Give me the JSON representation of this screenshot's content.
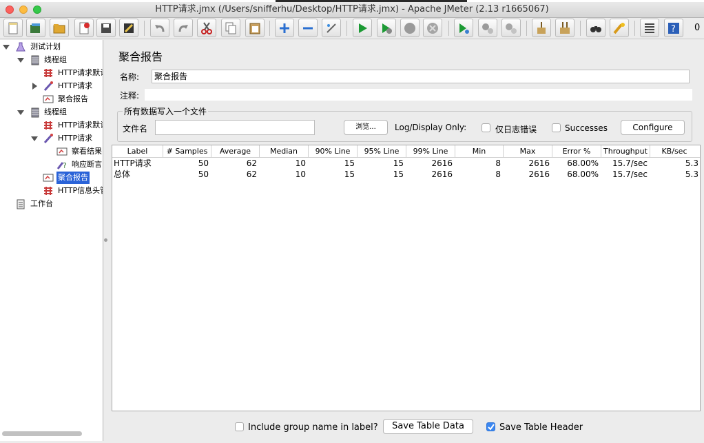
{
  "window": {
    "title": "HTTP请求.jmx (/Users/snifferhu/Desktop/HTTP请求.jmx) - Apache JMeter (2.13 r1665067)"
  },
  "toolbar": {
    "counter": "0"
  },
  "tree": {
    "nodes": [
      {
        "label": "测试计划",
        "icon": "test-plan-icon"
      },
      {
        "label": "线程组",
        "icon": "thread-group-icon"
      },
      {
        "label": "HTTP请求默认",
        "icon": "config-icon"
      },
      {
        "label": "HTTP请求",
        "icon": "sampler-icon"
      },
      {
        "label": "聚合报告",
        "icon": "report-icon"
      },
      {
        "label": "线程组",
        "icon": "thread-group-icon"
      },
      {
        "label": "HTTP请求默认",
        "icon": "config-icon"
      },
      {
        "label": "HTTP请求",
        "icon": "sampler-icon"
      },
      {
        "label": "察看结果",
        "icon": "listener-icon"
      },
      {
        "label": "响应断言",
        "icon": "assertion-icon"
      },
      {
        "label": "聚合报告",
        "icon": "report-icon"
      },
      {
        "label": "HTTP信息头管",
        "icon": "config-icon"
      },
      {
        "label": "工作台",
        "icon": "workbench-icon"
      }
    ]
  },
  "panel": {
    "title": "聚合报告",
    "name_label": "名称:",
    "name_value": "聚合报告",
    "comment_label": "注释:",
    "comment_value": "",
    "file_group_title": "所有数据写入一个文件",
    "filename_label": "文件名",
    "filename_value": "",
    "browse_label": "浏览...",
    "log_display_label": "Log/Display Only:",
    "errors_only_label": "仅日志错误",
    "successes_label": "Successes",
    "configure_label": "Configure"
  },
  "table": {
    "columns": [
      "Label",
      "# Samples",
      "Average",
      "Median",
      "90% Line",
      "95% Line",
      "99% Line",
      "Min",
      "Max",
      "Error %",
      "Throughput",
      "KB/sec"
    ],
    "rows": [
      [
        "HTTP请求",
        "50",
        "62",
        "10",
        "15",
        "15",
        "2616",
        "8",
        "2616",
        "68.00%",
        "15.7/sec",
        "5.3"
      ],
      [
        "总体",
        "50",
        "62",
        "10",
        "15",
        "15",
        "2616",
        "8",
        "2616",
        "68.00%",
        "15.7/sec",
        "5.3"
      ]
    ]
  },
  "footer": {
    "include_group_label": "Include group name in label?",
    "include_group_checked": false,
    "save_table_data_label": "Save Table Data",
    "save_table_header_label": "Save Table Header",
    "save_table_header_checked": true
  },
  "colors": {
    "selection": "#2a63d8",
    "checkbox_on": "#3b87f1"
  }
}
